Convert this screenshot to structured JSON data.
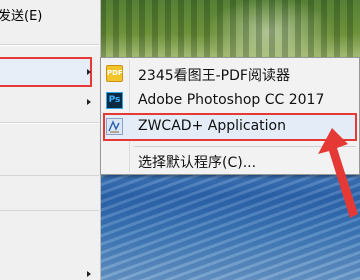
{
  "context_menu": {
    "items": [
      {
        "label": "发送(E)"
      }
    ]
  },
  "submenu": {
    "items": [
      {
        "label": "2345看图王-PDF阅读器",
        "icon": "pdf-icon",
        "icon_text": "PDF"
      },
      {
        "label": "Adobe Photoshop CC 2017",
        "icon": "photoshop-icon",
        "icon_text": "Ps"
      },
      {
        "label": "ZWCAD+ Application",
        "icon": "zwcad-icon"
      },
      {
        "label": "选择默认程序(C)..."
      }
    ]
  },
  "colors": {
    "highlight_border": "#e53935",
    "arrow": "#e53935"
  }
}
